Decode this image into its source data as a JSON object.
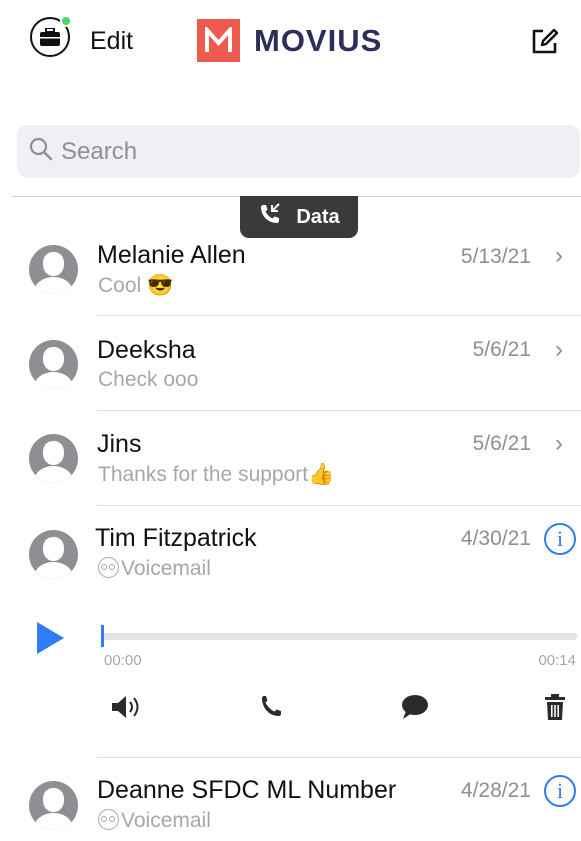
{
  "header": {
    "edit_label": "Edit",
    "brand": "MOVIUS",
    "brand_color": "#ee5a4e",
    "brand_text_color": "#2e2e5a",
    "status_dot_color": "#4cd964"
  },
  "search": {
    "placeholder": "Search"
  },
  "network_badge": {
    "label": "Data",
    "icon": "phone-arrows-icon"
  },
  "conversations": [
    {
      "name": "Melanie Allen",
      "preview": "Cool 😎",
      "date": "5/13/21",
      "action": "chevron"
    },
    {
      "name": "Deeksha",
      "preview": "Check ooo",
      "date": "5/6/21",
      "action": "chevron"
    },
    {
      "name": "Jins",
      "preview": "Thanks for the support👍",
      "date": "5/6/21",
      "action": "chevron"
    },
    {
      "name": "Tim Fitzpatrick",
      "preview": "Voicemail",
      "date": "4/30/21",
      "action": "info",
      "preview_icon": "voicemail-icon"
    },
    {
      "name": "Deanne SFDC ML Number",
      "preview": "Voicemail",
      "date": "4/28/21",
      "action": "info",
      "preview_icon": "voicemail-icon"
    }
  ],
  "player": {
    "elapsed": "00:00",
    "duration": "00:14",
    "progress": 0,
    "accent_color": "#2f7cf6",
    "actions": [
      "speaker-icon",
      "phone-icon",
      "message-bubble-icon",
      "trash-icon"
    ]
  },
  "glyphs": {
    "chevron": "›",
    "info": "i"
  }
}
